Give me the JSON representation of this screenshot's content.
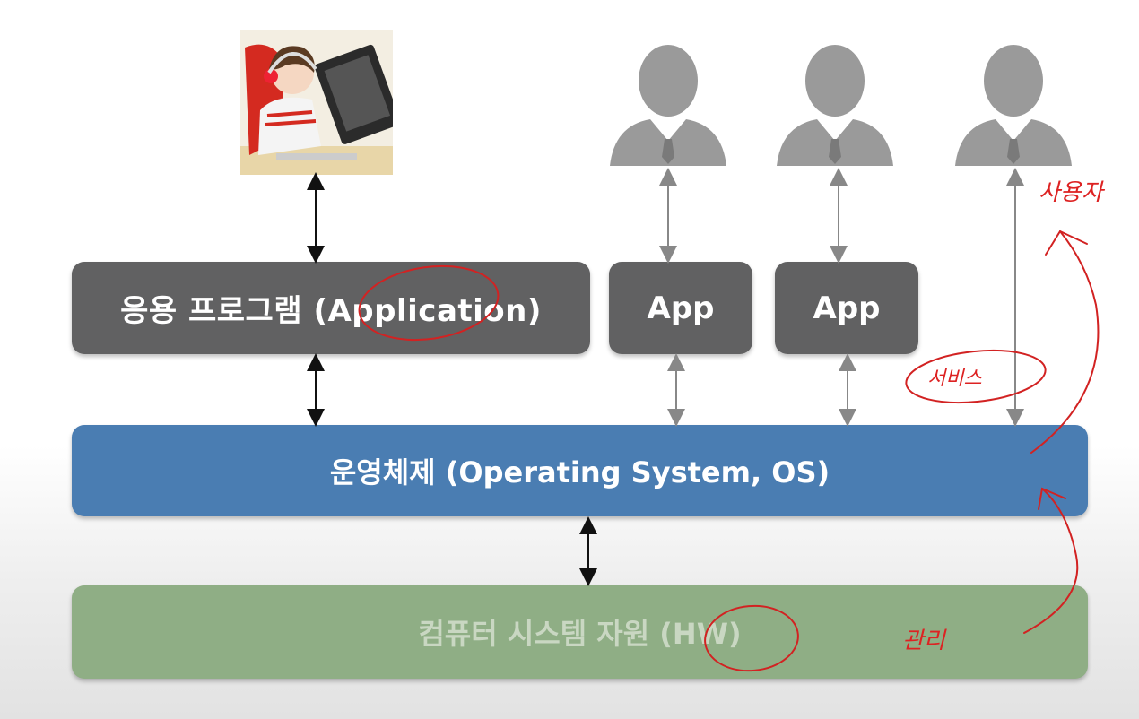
{
  "layers": {
    "application": "응용 프로그램 (Application)",
    "app1": "App",
    "app2": "App",
    "os": "운영체제 (Operating System, OS)",
    "hardware": "컴퓨터 시스템 자원 (HW)"
  },
  "annotations": {
    "user": "사용자",
    "service": "서비스",
    "manage": "관리"
  },
  "colors": {
    "app_box": "#616162",
    "os_box": "#4a7db2",
    "hw_box": "#8fae85",
    "annotation": "#d22222"
  }
}
